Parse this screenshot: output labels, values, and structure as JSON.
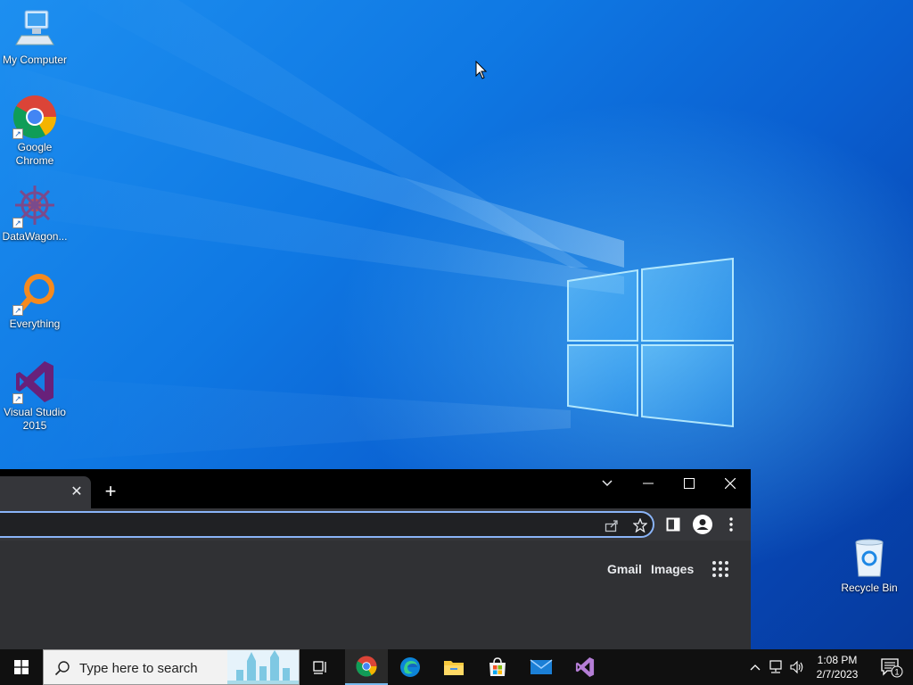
{
  "desktop": {
    "icons": [
      {
        "label": "My Computer",
        "icon": "computer-icon"
      },
      {
        "label": "Google Chrome",
        "icon": "chrome-icon"
      },
      {
        "label": "DataWagon...",
        "icon": "datawagon-icon"
      },
      {
        "label": "Everything",
        "icon": "everything-icon"
      },
      {
        "label": "Visual Studio 2015",
        "icon": "visual-studio-icon"
      }
    ],
    "recycle_bin": {
      "label": "Recycle Bin",
      "icon": "recycle-bin-icon"
    }
  },
  "chrome": {
    "tab": {
      "close": "✕"
    },
    "new_tab": "+",
    "omnibox": {
      "value": ""
    },
    "links": {
      "gmail": "Gmail",
      "images": "Images"
    },
    "colors": {
      "frame": "#000000",
      "toolbar": "#35363a",
      "omnibox_border": "#8ab4f8",
      "content": "#303134"
    }
  },
  "taskbar": {
    "search_placeholder": "Type here to search",
    "apps": [
      "task-view-icon",
      "chrome-icon",
      "edge-icon",
      "file-explorer-icon",
      "store-icon",
      "mail-icon",
      "visual-studio-icon"
    ],
    "clock": {
      "time": "1:08 PM",
      "date": "2/7/2023"
    },
    "notification_count": "1"
  }
}
